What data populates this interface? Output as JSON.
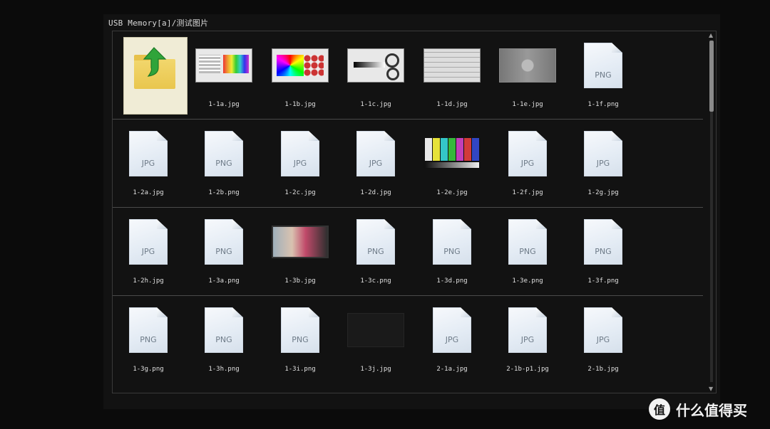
{
  "window": {
    "path": "USB Memory[a]/测试图片"
  },
  "rows": [
    [
      {
        "kind": "up",
        "label": ""
      },
      {
        "kind": "image",
        "variant": "chart1",
        "label": "1-1a.jpg"
      },
      {
        "kind": "image",
        "variant": "chart2",
        "label": "1-1b.jpg"
      },
      {
        "kind": "image",
        "variant": "chart3",
        "label": "1-1c.jpg"
      },
      {
        "kind": "image",
        "variant": "chart4",
        "label": "1-1d.jpg"
      },
      {
        "kind": "image",
        "variant": "chart5",
        "label": "1-1e.jpg"
      },
      {
        "kind": "file",
        "ext": "PNG",
        "label": "1-1f.png"
      }
    ],
    [
      {
        "kind": "file",
        "ext": "JPG",
        "label": "1-2a.jpg"
      },
      {
        "kind": "file",
        "ext": "PNG",
        "label": "1-2b.png"
      },
      {
        "kind": "file",
        "ext": "JPG",
        "label": "1-2c.jpg"
      },
      {
        "kind": "file",
        "ext": "JPG",
        "label": "1-2d.jpg"
      },
      {
        "kind": "image",
        "variant": "bars",
        "label": "1-2e.jpg"
      },
      {
        "kind": "file",
        "ext": "JPG",
        "label": "1-2f.jpg"
      },
      {
        "kind": "file",
        "ext": "JPG",
        "label": "1-2g.jpg"
      }
    ],
    [
      {
        "kind": "file",
        "ext": "JPG",
        "label": "1-2h.jpg"
      },
      {
        "kind": "file",
        "ext": "PNG",
        "label": "1-3a.png"
      },
      {
        "kind": "image",
        "variant": "photo",
        "label": "1-3b.jpg"
      },
      {
        "kind": "file",
        "ext": "PNG",
        "label": "1-3c.png"
      },
      {
        "kind": "file",
        "ext": "PNG",
        "label": "1-3d.png"
      },
      {
        "kind": "file",
        "ext": "PNG",
        "label": "1-3e.png"
      },
      {
        "kind": "file",
        "ext": "PNG",
        "label": "1-3f.png"
      }
    ],
    [
      {
        "kind": "file",
        "ext": "PNG",
        "label": "1-3g.png"
      },
      {
        "kind": "file",
        "ext": "PNG",
        "label": "1-3h.png"
      },
      {
        "kind": "file",
        "ext": "PNG",
        "label": "1-3i.png"
      },
      {
        "kind": "image",
        "variant": "dim",
        "label": "1-3j.jpg"
      },
      {
        "kind": "file",
        "ext": "JPG",
        "label": "2-1a.jpg"
      },
      {
        "kind": "file",
        "ext": "JPG",
        "label": "2-1b-p1.jpg"
      },
      {
        "kind": "file",
        "ext": "JPG",
        "label": "2-1b.jpg"
      }
    ]
  ],
  "colorbars": [
    "#e9e9e9",
    "#e6e23a",
    "#34c6c8",
    "#36b83b",
    "#c23fb9",
    "#d23a3a",
    "#3146c4"
  ],
  "watermark": {
    "badge": "值",
    "text": "什么值得买"
  }
}
